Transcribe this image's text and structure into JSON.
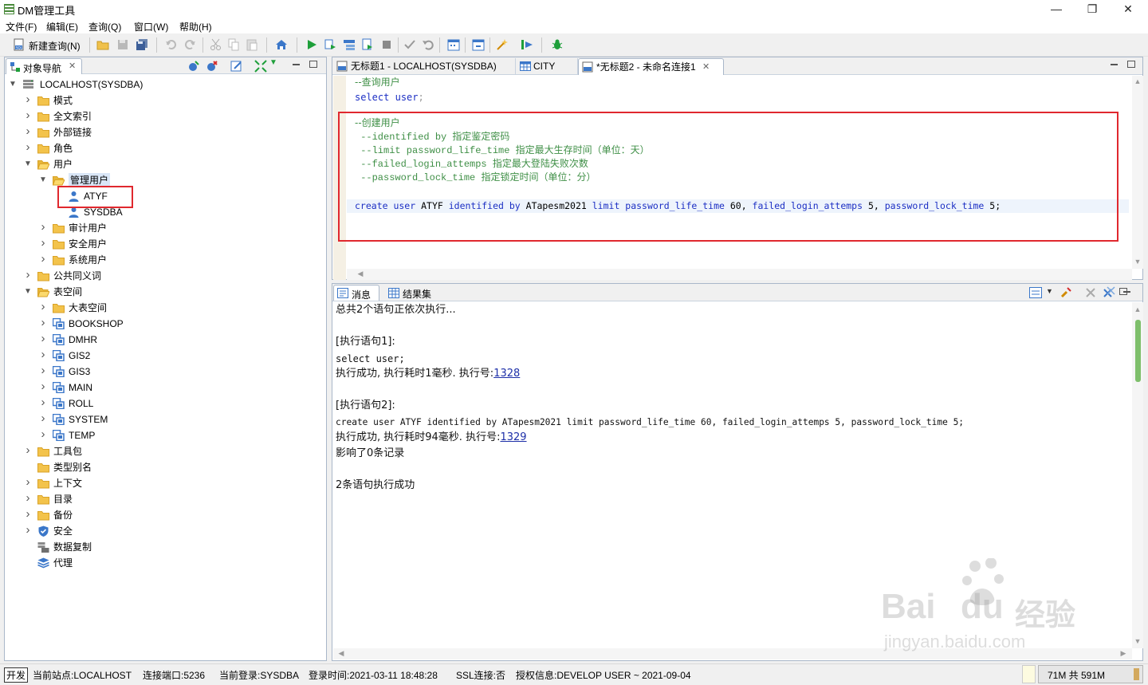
{
  "window": {
    "title": "DM管理工具",
    "controls": [
      "—",
      "❐",
      "✕"
    ]
  },
  "menu": [
    "文件(F)",
    "编辑(E)",
    "查询(Q)",
    "窗口(W)",
    "帮助(H)"
  ],
  "toolbar": {
    "new_query_label": "新建查询(N)"
  },
  "nav": {
    "tab_label": "对象导航",
    "root": "LOCALHOST(SYSDBA)",
    "items": [
      {
        "label": "模式"
      },
      {
        "label": "全文索引"
      },
      {
        "label": "外部链接"
      },
      {
        "label": "角色"
      },
      {
        "label": "用户"
      },
      {
        "label": "管理用户"
      },
      {
        "label": "ATYF"
      },
      {
        "label": "SYSDBA"
      },
      {
        "label": "审计用户"
      },
      {
        "label": "安全用户"
      },
      {
        "label": "系统用户"
      },
      {
        "label": "公共同义词"
      },
      {
        "label": "表空间"
      },
      {
        "label": "大表空间"
      },
      {
        "label": "BOOKSHOP"
      },
      {
        "label": "DMHR"
      },
      {
        "label": "GIS2"
      },
      {
        "label": "GIS3"
      },
      {
        "label": "MAIN"
      },
      {
        "label": "ROLL"
      },
      {
        "label": "SYSTEM"
      },
      {
        "label": "TEMP"
      },
      {
        "label": "工具包"
      },
      {
        "label": "类型别名"
      },
      {
        "label": "上下文"
      },
      {
        "label": "目录"
      },
      {
        "label": "备份"
      },
      {
        "label": "安全"
      },
      {
        "label": "数据复制"
      },
      {
        "label": "代理"
      }
    ]
  },
  "editor": {
    "tabs": [
      {
        "label": "无标题1 - LOCALHOST(SYSDBA)"
      },
      {
        "label": "CITY"
      },
      {
        "label": "*无标题2 - 未命名连接1"
      }
    ],
    "lines": {
      "l1": "--查询用户",
      "l2_kw1": "select",
      "l2_kw2": "user",
      "l2_end": ";",
      "l4": "--创建用户",
      "l5_a": " --identified by ",
      "l5_b": "指定鉴定密码",
      "l6_a": " --limit password_life_time ",
      "l6_b": "指定最大生存时间（单位：天）",
      "l7_a": " --failed_login_attemps ",
      "l7_b": "指定最大登陆失败次数",
      "l8_a": " --password_lock_time ",
      "l8_b": "指定锁定时间（单位：分）",
      "l10_k1": "create user",
      "l10_t1": " ATYF ",
      "l10_k2": "identified by",
      "l10_t2": " ATapesm2021 ",
      "l10_k3": "limit password_life_time",
      "l10_t3": " 60, ",
      "l10_k4": "failed_login_attemps",
      "l10_t4": " 5, ",
      "l10_k5": "password_lock_time",
      "l10_t5": " 5;"
    }
  },
  "results": {
    "tabs": [
      {
        "label": "消息"
      },
      {
        "label": "结果集"
      }
    ],
    "lines": {
      "m1": "总共2个语句正依次执行...",
      "m2": "[执行语句1]:",
      "m3": "select user;",
      "m4a": "执行成功, 执行耗时1毫秒. 执行号:",
      "m4b": "1328",
      "m5": "[执行语句2]:",
      "m6": "create user ATYF identified by ATapesm2021 limit password_life_time 60, failed_login_attemps 5, password_lock_time 5;",
      "m7a": "执行成功, 执行耗时94毫秒. 执行号:",
      "m7b": "1329",
      "m8": "影响了0条记录",
      "m9": "2条语句执行成功"
    }
  },
  "status": {
    "mode": "开发",
    "site": "当前站点:LOCALHOST",
    "port": "连接端口:5236",
    "login": "当前登录:SYSDBA",
    "time": "登录时间:2021-03-11 18:48:28",
    "ssl": "SSL连接:否",
    "license": "授权信息:DEVELOP USER ~ 2021-09-04",
    "memory": "71M 共 591M"
  },
  "watermark": {
    "brand": "Bai",
    "brand2": "du",
    "cn": "经验",
    "url": "jingyan.baidu.com"
  },
  "colors": {
    "keyword": "#1c2fc4",
    "comment": "#3f8f46",
    "highlight_box": "#e0282e"
  }
}
